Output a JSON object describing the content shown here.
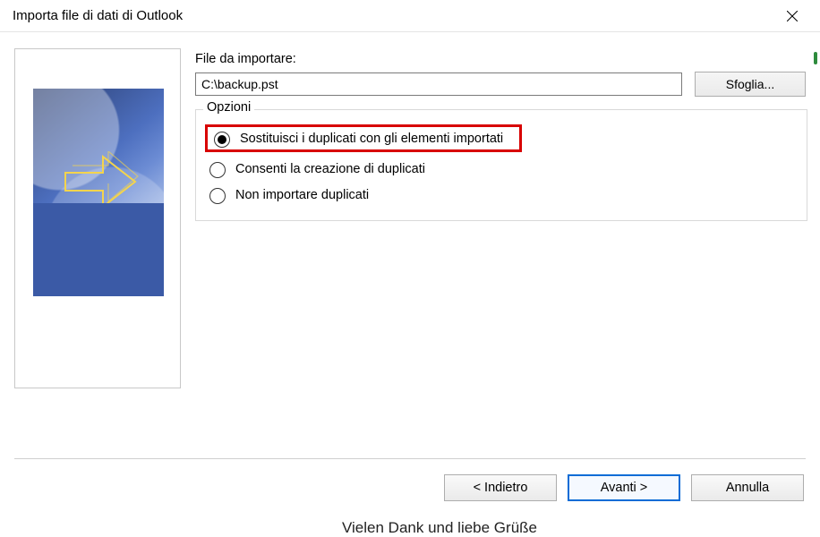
{
  "titlebar": {
    "title": "Importa file di dati di Outlook"
  },
  "form": {
    "file_label": "File da importare:",
    "file_value": "C:\\backup.pst",
    "browse_label": "Sfoglia..."
  },
  "options": {
    "legend": "Opzioni",
    "items": [
      {
        "label": "Sostituisci i duplicati con gli elementi importati",
        "checked": true,
        "highlight": true
      },
      {
        "label": "Consenti la creazione di duplicati",
        "checked": false,
        "highlight": false
      },
      {
        "label": "Non importare duplicati",
        "checked": false,
        "highlight": false
      }
    ]
  },
  "buttons": {
    "back": "< Indietro",
    "next": "Avanti >",
    "cancel": "Annulla"
  },
  "ghost": "Vielen Dank und liebe Grüße"
}
